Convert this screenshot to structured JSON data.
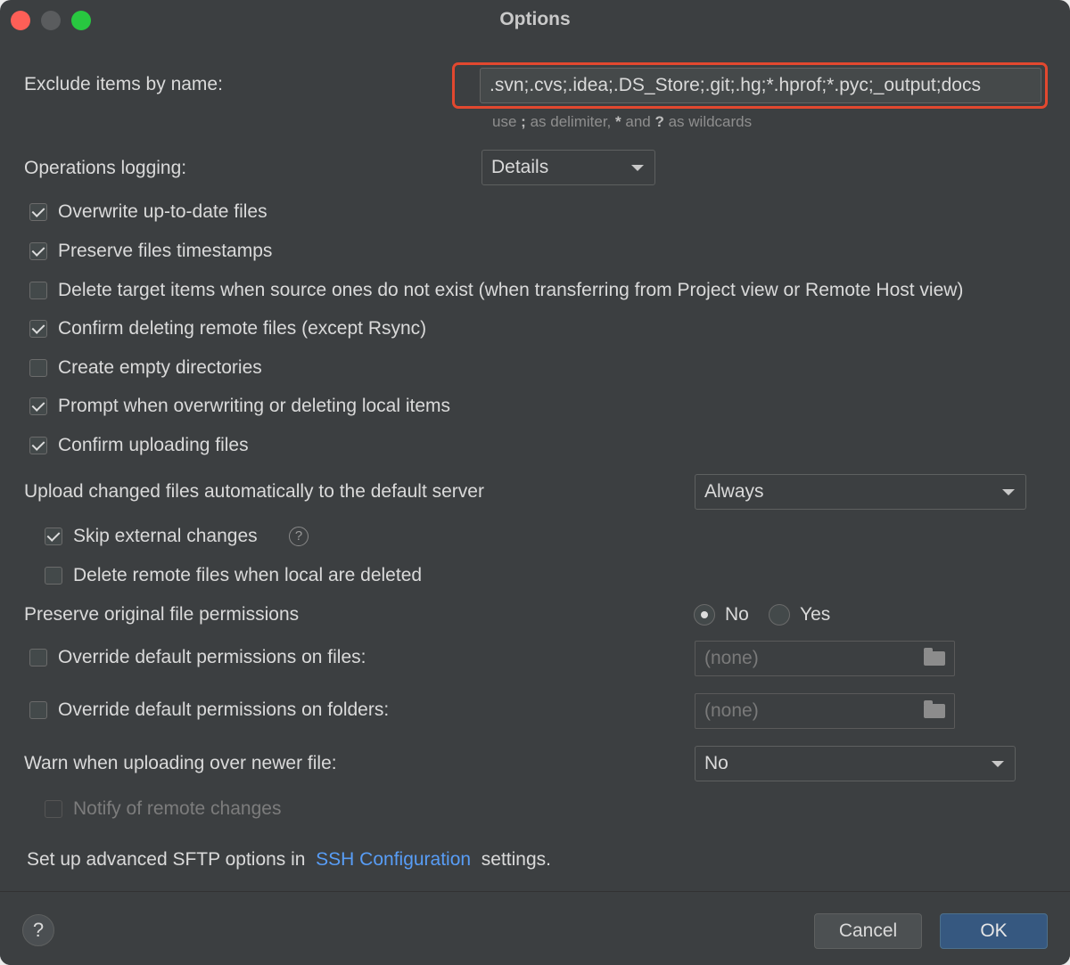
{
  "window": {
    "title": "Options"
  },
  "exclude": {
    "label": "Exclude items by name:",
    "value": ".svn;.cvs;.idea;.DS_Store;.git;.hg;*.hprof;*.pyc;_output;docs",
    "hint_prefix": "use",
    "hint_semicolon": ";",
    "hint_mid": "as delimiter,",
    "hint_star": "*",
    "hint_and": "and",
    "hint_q": "?",
    "hint_suffix": "as wildcards"
  },
  "logging": {
    "label": "Operations logging:",
    "value": "Details"
  },
  "checkboxes": [
    {
      "label": "Overwrite up-to-date files",
      "checked": true
    },
    {
      "label": "Preserve files timestamps",
      "checked": true
    },
    {
      "label": "Delete target items when source ones do not exist (when transferring from Project view or Remote Host view)",
      "checked": false
    },
    {
      "label": "Confirm deleting remote files (except Rsync)",
      "checked": true
    },
    {
      "label": "Create empty directories",
      "checked": false
    },
    {
      "label": "Prompt when overwriting or deleting local items",
      "checked": true
    },
    {
      "label": "Confirm uploading files",
      "checked": true
    }
  ],
  "upload": {
    "label": "Upload changed files automatically to the default server",
    "value": "Always",
    "skip_external": {
      "label": "Skip external changes",
      "checked": true,
      "help": "?"
    },
    "delete_remote": {
      "label": "Delete remote files when local are deleted",
      "checked": false
    }
  },
  "permissions": {
    "label": "Preserve original file permissions",
    "no_label": "No",
    "yes_label": "Yes",
    "selected": "No",
    "override_files": {
      "label": "Override default permissions on files:",
      "checked": false,
      "value": "(none)"
    },
    "override_folders": {
      "label": "Override default permissions on folders:",
      "checked": false,
      "value": "(none)"
    }
  },
  "warn": {
    "label": "Warn when uploading over newer file:",
    "value": "No"
  },
  "notify": {
    "label": "Notify of remote changes",
    "checked": false,
    "enabled": false
  },
  "sftp": {
    "prefix": "Set up advanced SFTP options in",
    "link": "SSH Configuration",
    "suffix": "settings."
  },
  "footer": {
    "help": "?",
    "cancel": "Cancel",
    "ok": "OK"
  },
  "colors": {
    "background": "#3c3f41",
    "accent": "#589df6",
    "ok_button": "#365880",
    "highlight": "#e2482f"
  }
}
